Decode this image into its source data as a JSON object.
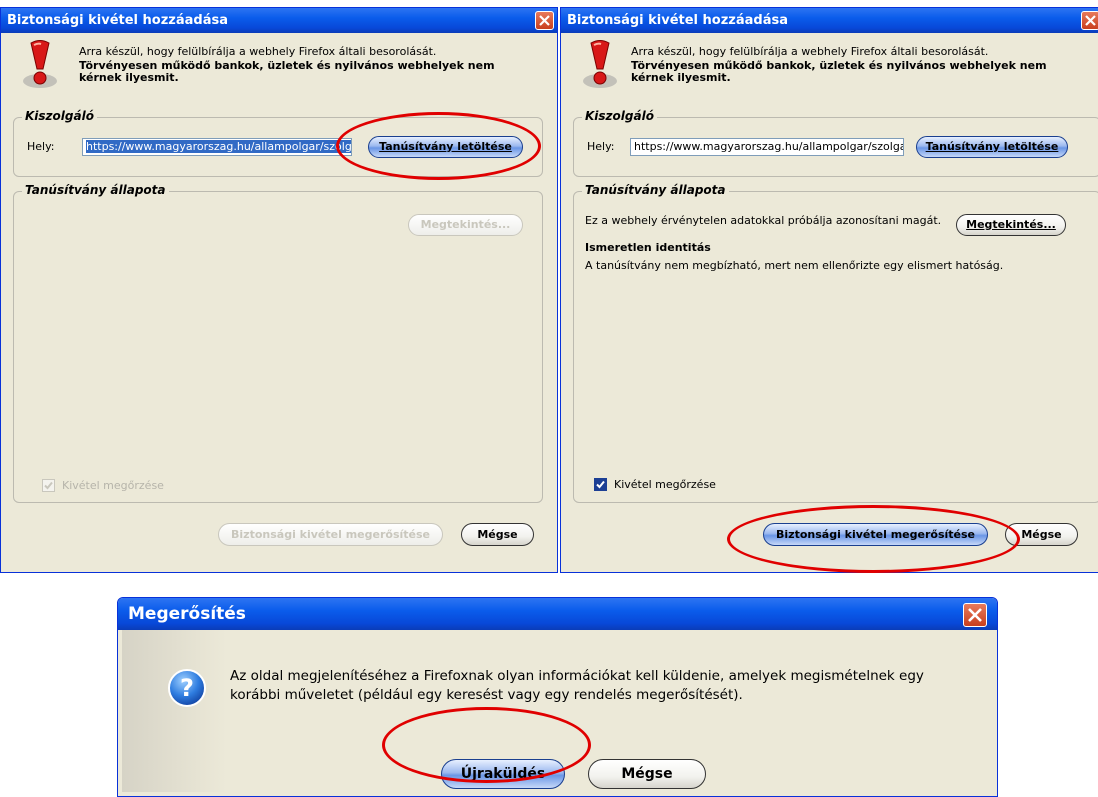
{
  "dialog_left": {
    "title": "Biztonsági kivétel hozzáadása",
    "warning_line1": "Arra készül, hogy felülbírálja a webhely Firefox általi besorolását.",
    "warning_line2": "Törvényesen működő bankok, üzletek és nyilvános webhelyek nem kérnek ilyesmit.",
    "server_group_label": "Kiszolgáló",
    "location_label": "Hely:",
    "location_value": "https://www.magyarorszag.hu/allampolgar/szolgalt",
    "get_cert_button": "Tanúsítvány letöltése",
    "status_group_label": "Tanúsítvány állapota",
    "view_button": "Megtekintés...",
    "keep_checkbox_label": "Kivétel megőrzése",
    "keep_checked": true,
    "confirm_button": "Biztonsági kivétel megerősítése",
    "cancel_button": "Mégse"
  },
  "dialog_right": {
    "title": "Biztonsági kivétel hozzáadása",
    "warning_line1": "Arra készül, hogy felülbírálja a webhely Firefox általi besorolását.",
    "warning_line2": "Törvényesen működő bankok, üzletek és nyilvános webhelyek nem kérnek ilyesmit.",
    "server_group_label": "Kiszolgáló",
    "location_label": "Hely:",
    "location_value": "https://www.magyarorszag.hu/allampolgar/szolgalt",
    "get_cert_button": "Tanúsítvány letöltése",
    "status_group_label": "Tanúsítvány állapota",
    "status_text": "Ez a webhely érvénytelen adatokkal próbálja azonosítani magát.",
    "view_button": "Megtekintés...",
    "unknown_identity_heading": "Ismeretlen identitás",
    "unknown_identity_text": "A tanúsítvány nem megbízható, mert nem ellenőrizte egy elismert hatóság.",
    "keep_checkbox_label": "Kivétel megőrzése",
    "keep_checked": true,
    "confirm_button": "Biztonsági kivétel megerősítése",
    "cancel_button": "Mégse"
  },
  "dialog_bottom": {
    "title": "Megerősítés",
    "message_line1": "Az oldal megjelenítéséhez a Firefoxnak olyan információkat kell küldenie, amelyek megismételnek egy",
    "message_line2": "korábbi műveletet (például egy keresést vagy egy rendelés megerősítését).",
    "resend_button": "Újraküldés",
    "cancel_button": "Mégse"
  },
  "colors": {
    "titlebar": "#0A5CEB",
    "dialog_bg": "#ECE9D8",
    "highlight_oval": "#E00000",
    "close_button": "#D8542F"
  },
  "icons": {
    "warning": "exclamation-warning-icon",
    "question": "question-icon",
    "close": "close-icon",
    "checkbox": "checkbox-checked-icon"
  }
}
